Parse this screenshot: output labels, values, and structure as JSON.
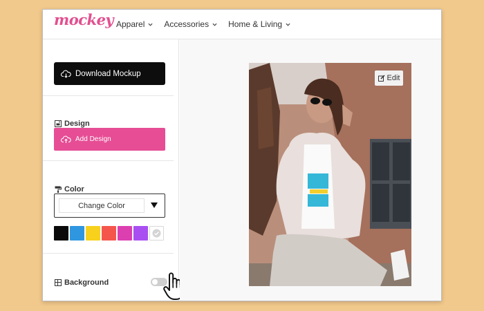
{
  "logo": {
    "text": "mockey",
    "color": "#e2508f"
  },
  "nav": {
    "items": [
      {
        "label": "Apparel",
        "icon": "chevron-down-icon"
      },
      {
        "label": "Accessories",
        "icon": "chevron-down-icon"
      },
      {
        "label": "Home & Living",
        "icon": "chevron-down-icon"
      }
    ]
  },
  "sidebar": {
    "download_label": "Download Mockup",
    "design": {
      "title": "Design",
      "add_label": "Add Design"
    },
    "color": {
      "title": "Color",
      "select_label": "Change Color",
      "swatches": [
        "#0a0a0a",
        "#2f96e0",
        "#f7d11c",
        "#f5564c",
        "#dc3fb0",
        "#a94ff2"
      ]
    },
    "background": {
      "title": "Background",
      "toggle_on": false
    }
  },
  "preview": {
    "edit_label": "Edit"
  },
  "colors": {
    "accent": "#e64d95",
    "dark": "#0d0d0d",
    "page_bg": "#f2c98c"
  }
}
